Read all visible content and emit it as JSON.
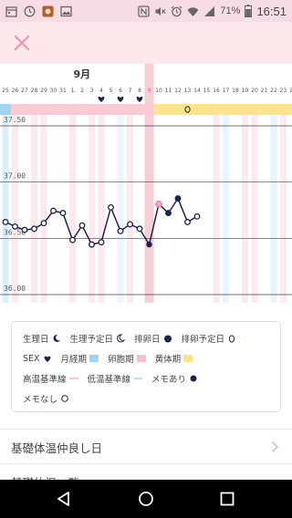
{
  "status_bar": {
    "battery": "71%",
    "time": "16:51",
    "icons": [
      "calendar-icon",
      "clock-icon",
      "app-icon",
      "image-icon",
      "nfc-icon",
      "mute-icon",
      "alarm-icon",
      "wifi-icon",
      "signal-icon",
      "battery-icon"
    ]
  },
  "app_bar": {
    "close_icon": "close-icon"
  },
  "chart_data": {
    "type": "line",
    "month_label": "9月",
    "day_labels": [
      "25",
      "26",
      "27",
      "28",
      "29",
      "30",
      "31",
      "1",
      "2",
      "3",
      "4",
      "5",
      "6",
      "7",
      "8",
      "9",
      "10",
      "11",
      "12",
      "13",
      "14",
      "15",
      "16",
      "17",
      "18",
      "19",
      "20",
      "21",
      "22",
      "23",
      "24"
    ],
    "y_ticks": [
      "37.50",
      "37.00",
      "36.50",
      "36.00"
    ],
    "ylim": [
      35.9,
      37.7
    ],
    "points": [
      {
        "day": "25",
        "temp": 36.58
      },
      {
        "day": "26",
        "temp": 36.54
      },
      {
        "day": "27",
        "temp": 36.51
      },
      {
        "day": "28",
        "temp": 36.52
      },
      {
        "day": "29",
        "temp": 36.57
      },
      {
        "day": "30",
        "temp": 36.68
      },
      {
        "day": "31",
        "temp": 36.66
      },
      {
        "day": "1",
        "temp": 36.42
      },
      {
        "day": "2",
        "temp": 36.55
      },
      {
        "day": "3",
        "temp": 36.38
      },
      {
        "day": "4",
        "temp": 36.4
      },
      {
        "day": "5",
        "temp": 36.71
      },
      {
        "day": "6",
        "temp": 36.5
      },
      {
        "day": "7",
        "temp": 36.56
      },
      {
        "day": "8",
        "temp": 36.52
      },
      {
        "day": "9",
        "temp": 36.38
      },
      {
        "day": "10",
        "temp": 36.74
      },
      {
        "day": "11",
        "temp": 36.66
      },
      {
        "day": "12",
        "temp": 36.79
      },
      {
        "day": "13",
        "temp": 36.58
      },
      {
        "day": "14",
        "temp": 36.63
      }
    ],
    "highlight_day": "9",
    "sex_days": [
      "4",
      "6",
      "8"
    ],
    "memo_none_day": "13",
    "colors": {
      "line": "#1b2551",
      "highlight_point": "#f3a6b8",
      "ovulation_band": "#f3c5cf",
      "menstrual_band": "#9fd3f0",
      "luteal_band": "#fbe48c",
      "grid": "#555555"
    }
  },
  "legend": {
    "rows": [
      [
        {
          "label": "生理日",
          "icon": "moon-filled-icon"
        },
        {
          "label": "生理予定日",
          "icon": "moon-outline-icon"
        },
        {
          "label": "排卵日",
          "icon": "drop-filled-icon"
        },
        {
          "label": "排卵予定日",
          "icon": "drop-outline-icon"
        }
      ],
      [
        {
          "label": "SEX",
          "icon": "heart-icon"
        },
        {
          "label": "月経期",
          "icon": "blue-square-icon"
        },
        {
          "label": "卵胞期",
          "icon": "pink-square-icon"
        },
        {
          "label": "黄体期",
          "icon": "yellow-square-icon"
        }
      ],
      [
        {
          "label": "高温基準線",
          "icon": "pink-line-icon"
        },
        {
          "label": "低温基準線",
          "icon": "blue-line-icon"
        },
        {
          "label": "メモあり",
          "icon": "navy-dot-icon"
        }
      ],
      [
        {
          "label": "メモなし",
          "icon": "hollow-circle-icon"
        }
      ]
    ]
  },
  "list": {
    "item1": "基礎体温仲良し日",
    "item2": "基礎体温一覧"
  },
  "nav": {
    "back": "back-icon",
    "home": "home-icon",
    "recents": "recents-icon"
  }
}
